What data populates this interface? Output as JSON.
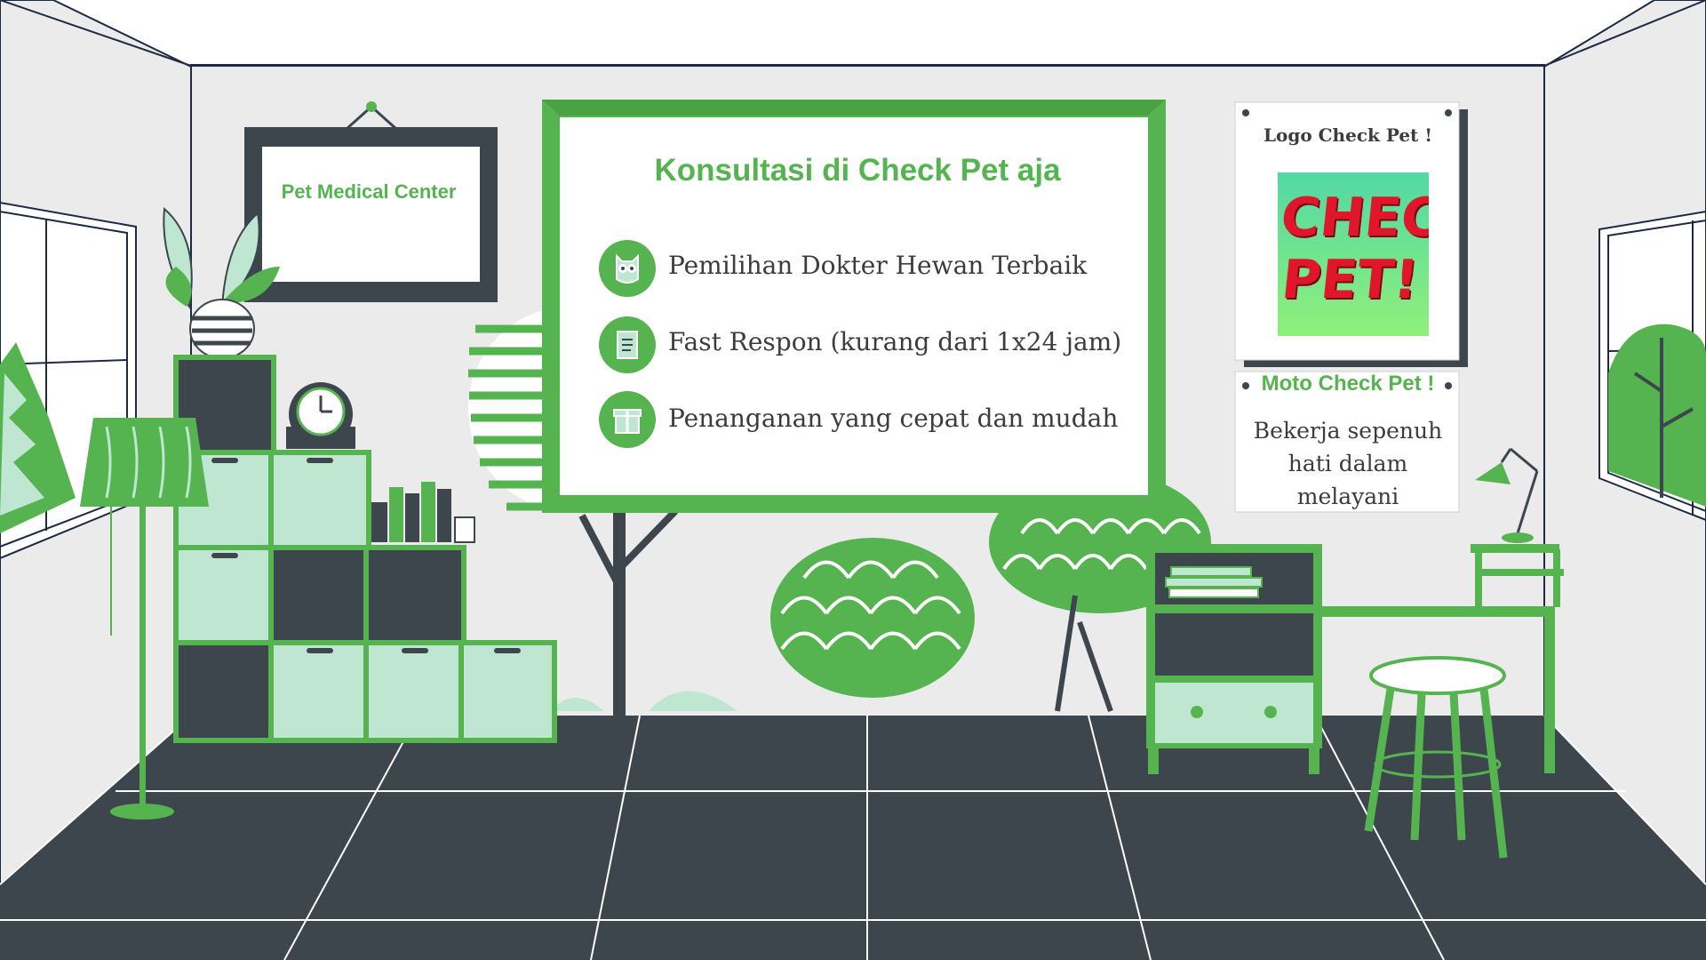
{
  "wall_frame": {
    "title": "Pet Medical Center"
  },
  "board": {
    "title": "Konsultasi di Check Pet aja",
    "items": [
      {
        "icon": "owl-icon",
        "text": "Pemilihan Dokter Hewan Terbaik"
      },
      {
        "icon": "notebook-icon",
        "text": "Fast Respon (kurang dari 1x24 jam)"
      },
      {
        "icon": "gift-icon",
        "text": "Penanganan yang cepat dan mudah"
      }
    ]
  },
  "logo_poster": {
    "caption": "Logo Check Pet !",
    "logo_text": "CHECK PET!"
  },
  "moto_poster": {
    "title": "Moto Check Pet !",
    "text": "Bekerja sepenuh hati dalam melayani"
  },
  "colors": {
    "green": "#56b450",
    "dark": "#3c464c",
    "mint": "#bfe6d1",
    "wall": "#ebebeb",
    "logo_red": "#e0162b"
  }
}
